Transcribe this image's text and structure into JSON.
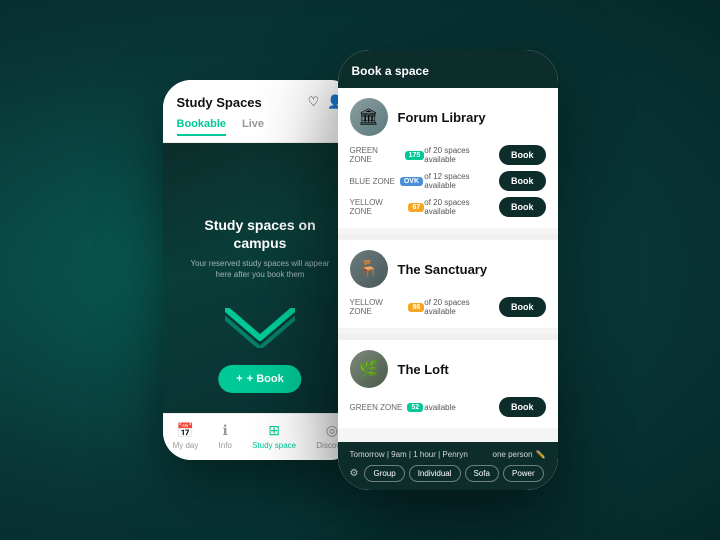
{
  "background": {
    "color": "#0d4a45"
  },
  "phone_back": {
    "header": {
      "title": "Study Spaces",
      "icons": [
        "heart",
        "user"
      ]
    },
    "tabs": [
      {
        "label": "Bookable",
        "active": true
      },
      {
        "label": "Live",
        "active": false
      }
    ],
    "hero": {
      "title": "Study spaces on campus",
      "subtitle": "Your reserved study spaces will appear here after you book them"
    },
    "book_button": "+ Book",
    "nav_items": [
      {
        "label": "My day",
        "icon": "📅",
        "active": false
      },
      {
        "label": "Info",
        "icon": "ℹ",
        "active": false
      },
      {
        "label": "Study space",
        "icon": "⊞",
        "active": true
      },
      {
        "label": "Discover",
        "icon": "◎",
        "active": false
      }
    ]
  },
  "phone_front": {
    "header": {
      "title": "Book a space"
    },
    "spaces": [
      {
        "name": "Forum Library",
        "thumb_emoji": "🏛",
        "zones": [
          {
            "label": "GREEN ZONE",
            "badge": "175",
            "badge_color": "green",
            "spaces_text": "of 20 spaces available"
          },
          {
            "label": "BLUE ZONE",
            "badge": "OVK",
            "badge_color": "blue",
            "spaces_text": "of 12 spaces available"
          },
          {
            "label": "YELLOW ZONE",
            "badge": "67",
            "badge_color": "yellow",
            "spaces_text": "of 20 spaces available"
          }
        ]
      },
      {
        "name": "The Sanctuary",
        "thumb_emoji": "🪑",
        "zones": [
          {
            "label": "YELLOW ZONE",
            "badge": "96",
            "badge_color": "yellow",
            "spaces_text": "of 20 spaces available"
          }
        ]
      },
      {
        "name": "The Loft",
        "thumb_emoji": "🌿",
        "zones": [
          {
            "label": "GREEN ZONE",
            "badge": "52",
            "badge_color": "green",
            "spaces_text": "available"
          }
        ]
      }
    ],
    "bottom": {
      "booking_time": "Tomorrow | 9am | 1 hour | Penryn",
      "booking_person": "one person",
      "filter_tags": [
        "Group",
        "Individual",
        "Sofa",
        "Power"
      ]
    }
  }
}
